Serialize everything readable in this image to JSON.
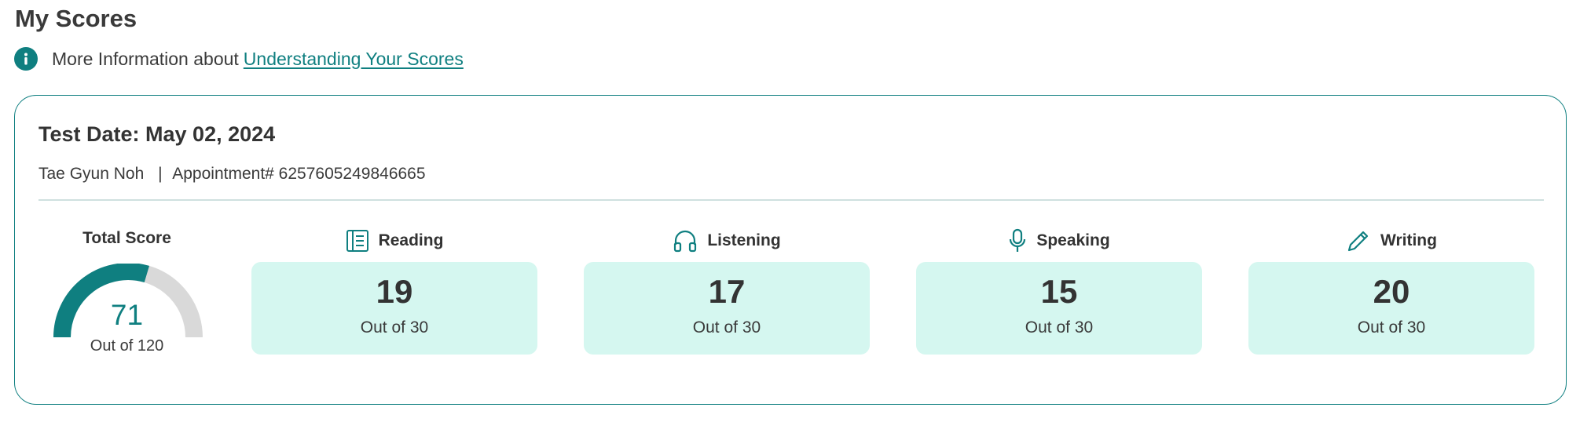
{
  "page": {
    "title": "My Scores"
  },
  "info": {
    "icon": "info-icon",
    "text": "More Information about",
    "link": "Understanding Your Scores"
  },
  "card": {
    "test_date": "Test Date: May 02, 2024",
    "name": "Tae Gyun Noh",
    "separator": "|",
    "appointment": "Appointment# 6257605249846665"
  },
  "total": {
    "label": "Total Score",
    "score": "71",
    "out_of": "Out of 120",
    "score_value": 71,
    "max_value": 120,
    "fill_color": "#0f7f80",
    "track_color": "#d9d9d9"
  },
  "sections": [
    {
      "label": "Reading",
      "icon": "book-icon",
      "score": "19",
      "out_of": "Out of 30"
    },
    {
      "label": "Listening",
      "icon": "headphones-icon",
      "score": "17",
      "out_of": "Out of 30"
    },
    {
      "label": "Speaking",
      "icon": "microphone-icon",
      "score": "15",
      "out_of": "Out of 30"
    },
    {
      "label": "Writing",
      "icon": "pencil-icon",
      "score": "20",
      "out_of": "Out of 30"
    }
  ],
  "colors": {
    "accent": "#0f7f80",
    "score_box_bg": "#d5f7f0",
    "text": "#333333"
  }
}
